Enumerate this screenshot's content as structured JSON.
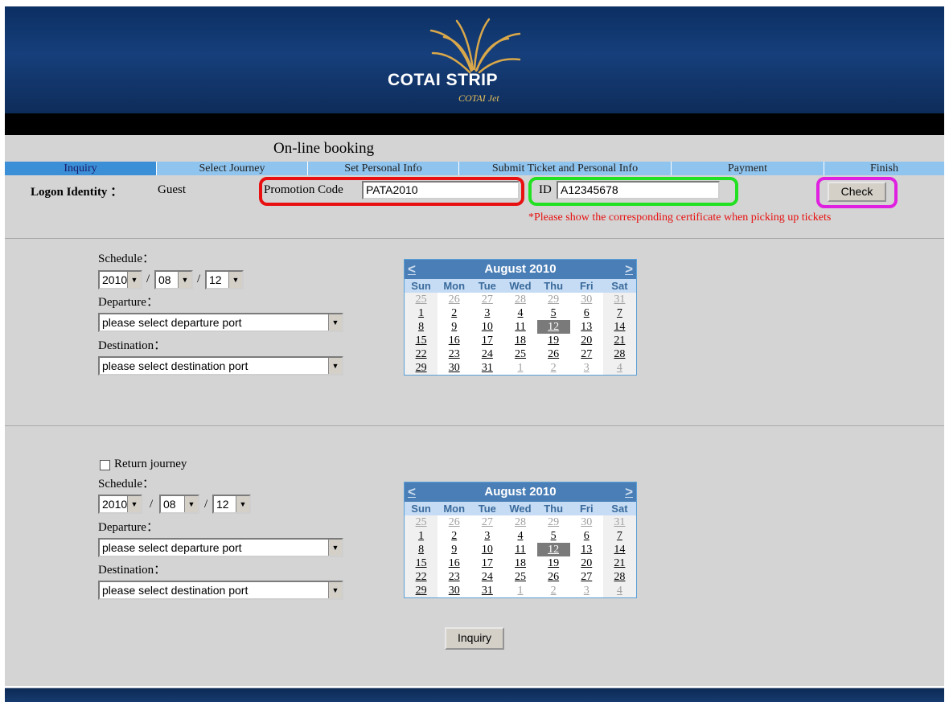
{
  "banner": {
    "logo_text": "COTAI STRIP",
    "logo_sub": "COTAI Jet"
  },
  "page": {
    "title": "On-line booking"
  },
  "steps": [
    {
      "label": "Inquiry"
    },
    {
      "label": "Select Journey"
    },
    {
      "label": "Set Personal Info"
    },
    {
      "label": "Submit Ticket and Personal Info"
    },
    {
      "label": "Payment"
    },
    {
      "label": "Finish"
    }
  ],
  "logon": {
    "label": "Logon Identity",
    "colon": "：",
    "value": "Guest"
  },
  "promo": {
    "label": "Promotion Code",
    "value": "PATA2010"
  },
  "id": {
    "label": "ID",
    "value": "A12345678"
  },
  "check_button": "Check",
  "notice": "*Please show the corresponding certificate when picking up tickets",
  "outbound": {
    "schedule_label": "Schedule：",
    "year": "2010",
    "month": "08",
    "day": "12",
    "departure_label": "Departure：",
    "departure_value": "please select departure port",
    "destination_label": "Destination：",
    "destination_value": "please select destination port"
  },
  "return": {
    "checkbox_label": "Return journey",
    "checked": false,
    "schedule_label": "Schedule：",
    "year": "2010",
    "month": "08",
    "day": "12",
    "departure_label": "Departure：",
    "departure_value": "please select departure port",
    "destination_label": "Destination：",
    "destination_value": "please select destination port"
  },
  "calendar": {
    "prev": "<",
    "next": ">",
    "title": "August 2010",
    "weekdays": [
      "Sun",
      "Mon",
      "Tue",
      "Wed",
      "Thu",
      "Fri",
      "Sat"
    ],
    "weeks": [
      [
        "25",
        "26",
        "27",
        "28",
        "29",
        "30",
        "31"
      ],
      [
        "1",
        "2",
        "3",
        "4",
        "5",
        "6",
        "7"
      ],
      [
        "8",
        "9",
        "10",
        "11",
        "12",
        "13",
        "14"
      ],
      [
        "15",
        "16",
        "17",
        "18",
        "19",
        "20",
        "21"
      ],
      [
        "22",
        "23",
        "24",
        "25",
        "26",
        "27",
        "28"
      ],
      [
        "29",
        "30",
        "31",
        "1",
        "2",
        "3",
        "4"
      ]
    ],
    "selected": "12"
  },
  "inquiry_button": "Inquiry",
  "slash": "/",
  "colors": {
    "banner": "#163f7b",
    "panel": "#d4d4d4",
    "promo_highlight": "#e81010",
    "id_highlight": "#22e022",
    "check_highlight": "#e020e0",
    "notice": "#e81010"
  }
}
